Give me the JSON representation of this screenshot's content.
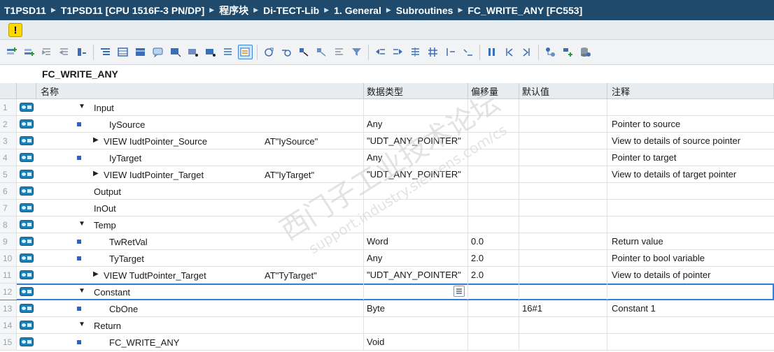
{
  "breadcrumb": [
    "T1PSD11",
    "T1PSD11 [CPU 1516F-3 PN/DP]",
    "程序块",
    "Di-TECT-Lib",
    "1. General",
    "Subroutines",
    "FC_WRITE_ANY [FC553]"
  ],
  "warning_symbol": "!",
  "block_name": "FC_WRITE_ANY",
  "columns": {
    "name": "名称",
    "type": "数据类型",
    "offset": "偏移量",
    "default": "默认值",
    "comment": "注释"
  },
  "rows": [
    {
      "num": "1",
      "name": "Input",
      "type": "",
      "offset": "",
      "default": "",
      "comment": "",
      "kind": "section",
      "expanded": true
    },
    {
      "num": "2",
      "name": "IySource",
      "type": "Any",
      "offset": "",
      "default": "",
      "comment": "Pointer to source",
      "kind": "var"
    },
    {
      "num": "3",
      "name": "VIEW IudtPointer_Source",
      "at": "AT\"IySource\"",
      "type": "\"UDT_ANY_POINTER\"",
      "offset": "",
      "default": "",
      "comment": "View to details of source pointer",
      "kind": "view"
    },
    {
      "num": "4",
      "name": "IyTarget",
      "type": "Any",
      "offset": "",
      "default": "",
      "comment": "Pointer to target",
      "kind": "var"
    },
    {
      "num": "5",
      "name": "VIEW IudtPointer_Target",
      "at": "AT\"IyTarget\"",
      "type": "\"UDT_ANY_POINTER\"",
      "offset": "",
      "default": "",
      "comment": "View to details of target pointer",
      "kind": "view"
    },
    {
      "num": "6",
      "name": "Output",
      "type": "",
      "offset": "",
      "default": "",
      "comment": "",
      "kind": "section-empty"
    },
    {
      "num": "7",
      "name": "InOut",
      "type": "",
      "offset": "",
      "default": "",
      "comment": "",
      "kind": "section-empty"
    },
    {
      "num": "8",
      "name": "Temp",
      "type": "",
      "offset": "",
      "default": "",
      "comment": "",
      "kind": "section",
      "expanded": true
    },
    {
      "num": "9",
      "name": "TwRetVal",
      "type": "Word",
      "offset": "0.0",
      "default": "",
      "comment": "Return value",
      "kind": "var"
    },
    {
      "num": "10",
      "name": "TyTarget",
      "type": "Any",
      "offset": "2.0",
      "default": "",
      "comment": "Pointer to bool variable",
      "kind": "var"
    },
    {
      "num": "11",
      "name": "VIEW TudtPointer_Target",
      "at": "AT\"TyTarget\"",
      "type": "\"UDT_ANY_POINTER\"",
      "offset": "2.0",
      "default": "",
      "comment": "View to details of pointer",
      "kind": "view"
    },
    {
      "num": "12",
      "name": "Constant",
      "type": "",
      "offset": "",
      "default": "",
      "comment": "",
      "kind": "section",
      "expanded": true,
      "selected": true
    },
    {
      "num": "13",
      "name": "CbOne",
      "type": "Byte",
      "offset": "",
      "default": "16#1",
      "comment": "Constant 1",
      "kind": "var"
    },
    {
      "num": "14",
      "name": "Return",
      "type": "",
      "offset": "",
      "default": "",
      "comment": "",
      "kind": "section",
      "expanded": true
    },
    {
      "num": "15",
      "name": "FC_WRITE_ANY",
      "type": "Void",
      "offset": "",
      "default": "",
      "comment": "",
      "kind": "var"
    }
  ],
  "watermark": {
    "line1": "西门子工业技术论坛",
    "line2": "support.industry.siemens.com/cs"
  },
  "colors": {
    "titlebar": "#1f4a6b",
    "accent": "#3a7fd6",
    "warning": "#ffd800",
    "interface_icon": "#1c7fb8"
  }
}
